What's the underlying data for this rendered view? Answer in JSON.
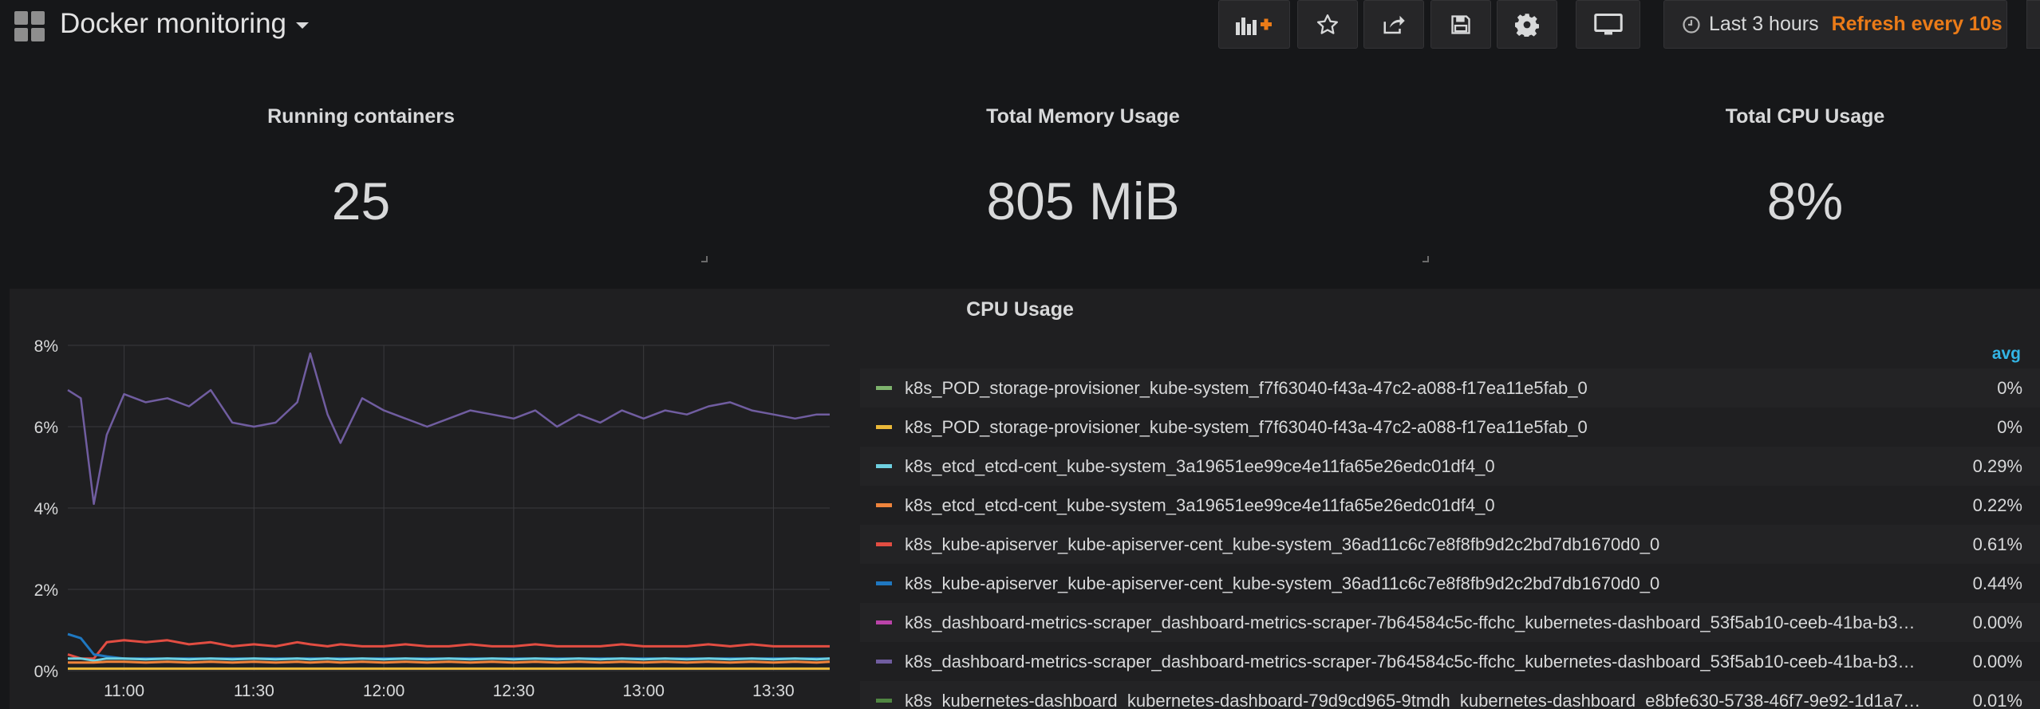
{
  "header": {
    "title": "Docker monitoring",
    "time_range": "Last 3 hours",
    "refresh": "Refresh every 10s",
    "buttons": [
      "add-panel-icon",
      "star-icon",
      "share-icon",
      "save-icon",
      "settings-icon",
      "tv-mode-icon"
    ]
  },
  "stats": [
    {
      "title": "Running containers",
      "value": "25"
    },
    {
      "title": "Total Memory Usage",
      "value": "805 MiB"
    },
    {
      "title": "Total CPU Usage",
      "value": "8%"
    }
  ],
  "graph": {
    "title": "CPU Usage",
    "legend_header": "avg",
    "legend": [
      {
        "name": "k8s_POD_storage-provisioner_kube-system_f7f63040-f43a-47c2-a088-f17ea11e5fab_0",
        "value": "0%",
        "color": "#7eb26d"
      },
      {
        "name": "k8s_POD_storage-provisioner_kube-system_f7f63040-f43a-47c2-a088-f17ea11e5fab_0",
        "value": "0%",
        "color": "#eab839"
      },
      {
        "name": "k8s_etcd_etcd-cent_kube-system_3a19651ee99ce4e11fa65e26edc01df4_0",
        "value": "0.29%",
        "color": "#6ed0e0"
      },
      {
        "name": "k8s_etcd_etcd-cent_kube-system_3a19651ee99ce4e11fa65e26edc01df4_0",
        "value": "0.22%",
        "color": "#ef843c"
      },
      {
        "name": "k8s_kube-apiserver_kube-apiserver-cent_kube-system_36ad11c6c7e8f8fb9d2c2bd7db1670d0_0",
        "value": "0.61%",
        "color": "#e24d42"
      },
      {
        "name": "k8s_kube-apiserver_kube-apiserver-cent_kube-system_36ad11c6c7e8f8fb9d2c2bd7db1670d0_0",
        "value": "0.44%",
        "color": "#1f78c1"
      },
      {
        "name": "k8s_dashboard-metrics-scraper_dashboard-metrics-scraper-7b64584c5c-ffchc_kubernetes-dashboard_53f5ab10-ceeb-41ba-b3…",
        "value": "0.00%",
        "color": "#ba43a9"
      },
      {
        "name": "k8s_dashboard-metrics-scraper_dashboard-metrics-scraper-7b64584c5c-ffchc_kubernetes-dashboard_53f5ab10-ceeb-41ba-b3…",
        "value": "0.00%",
        "color": "#705da0"
      },
      {
        "name": "k8s_kubernetes-dashboard_kubernetes-dashboard-79d9cd965-9tmdh_kubernetes-dashboard_e8bfe630-5738-46f7-9e92-1d1a7…",
        "value": "0.01%",
        "color": "#508642"
      }
    ]
  },
  "chart_data": {
    "type": "line",
    "title": "CPU Usage",
    "x_ticks": [
      "11:00",
      "11:30",
      "12:00",
      "12:30",
      "13:00",
      "13:30"
    ],
    "y_ticks": [
      "0%",
      "2%",
      "4%",
      "6%",
      "8%"
    ],
    "ylim": [
      0,
      8
    ],
    "x": [
      "10:47",
      "10:50",
      "10:53",
      "10:56",
      "11:00",
      "11:05",
      "11:10",
      "11:15",
      "11:20",
      "11:25",
      "11:30",
      "11:35",
      "11:40",
      "11:43",
      "11:47",
      "11:50",
      "11:55",
      "12:00",
      "12:05",
      "12:10",
      "12:15",
      "12:20",
      "12:25",
      "12:30",
      "12:35",
      "12:40",
      "12:45",
      "12:50",
      "12:55",
      "13:00",
      "13:05",
      "13:10",
      "13:15",
      "13:20",
      "13:25",
      "13:30",
      "13:35",
      "13:40",
      "13:43"
    ],
    "series": [
      {
        "color": "#705da0",
        "values": [
          6.9,
          6.7,
          4.1,
          5.8,
          6.8,
          6.6,
          6.7,
          6.5,
          6.9,
          6.1,
          6.0,
          6.1,
          6.6,
          7.8,
          6.3,
          5.6,
          6.7,
          6.4,
          6.2,
          6.0,
          6.2,
          6.4,
          6.3,
          6.2,
          6.4,
          6.0,
          6.3,
          6.1,
          6.4,
          6.2,
          6.4,
          6.3,
          6.5,
          6.6,
          6.4,
          6.3,
          6.2,
          6.3,
          6.3
        ]
      },
      {
        "color": "#e24d42",
        "values": [
          0.4,
          0.3,
          0.3,
          0.7,
          0.75,
          0.7,
          0.75,
          0.65,
          0.7,
          0.6,
          0.65,
          0.6,
          0.7,
          0.65,
          0.6,
          0.65,
          0.6,
          0.6,
          0.65,
          0.6,
          0.6,
          0.65,
          0.6,
          0.6,
          0.65,
          0.6,
          0.6,
          0.6,
          0.65,
          0.6,
          0.6,
          0.6,
          0.65,
          0.6,
          0.65,
          0.6,
          0.6,
          0.6,
          0.6
        ]
      },
      {
        "color": "#1f78c1",
        "values": [
          0.9,
          0.8,
          0.4,
          0.35,
          0.3,
          0.3,
          0.3,
          0.3,
          0.3,
          0.3,
          0.3,
          0.3,
          0.3,
          0.3,
          0.3,
          0.3,
          0.3,
          0.3,
          0.3,
          0.3,
          0.3,
          0.3,
          0.3,
          0.3,
          0.3,
          0.3,
          0.3,
          0.3,
          0.3,
          0.3,
          0.3,
          0.3,
          0.3,
          0.3,
          0.3,
          0.3,
          0.3,
          0.3,
          0.3
        ]
      },
      {
        "color": "#6ed0e0",
        "values": [
          0.3,
          0.3,
          0.25,
          0.3,
          0.3,
          0.28,
          0.3,
          0.28,
          0.3,
          0.28,
          0.3,
          0.28,
          0.3,
          0.28,
          0.3,
          0.28,
          0.3,
          0.28,
          0.3,
          0.28,
          0.3,
          0.28,
          0.3,
          0.28,
          0.3,
          0.28,
          0.3,
          0.28,
          0.3,
          0.28,
          0.3,
          0.28,
          0.3,
          0.28,
          0.3,
          0.28,
          0.3,
          0.28,
          0.3
        ]
      },
      {
        "color": "#ef843c",
        "values": [
          0.2,
          0.2,
          0.2,
          0.22,
          0.22,
          0.2,
          0.22,
          0.2,
          0.22,
          0.2,
          0.22,
          0.2,
          0.22,
          0.2,
          0.22,
          0.2,
          0.22,
          0.2,
          0.22,
          0.2,
          0.22,
          0.2,
          0.22,
          0.2,
          0.22,
          0.2,
          0.22,
          0.2,
          0.22,
          0.2,
          0.22,
          0.2,
          0.22,
          0.2,
          0.22,
          0.2,
          0.22,
          0.2,
          0.22
        ]
      },
      {
        "color": "#eab839",
        "values": [
          0.05,
          0.05,
          0.05,
          0.05,
          0.05,
          0.05,
          0.05,
          0.05,
          0.05,
          0.05,
          0.05,
          0.05,
          0.05,
          0.05,
          0.05,
          0.05,
          0.05,
          0.05,
          0.05,
          0.05,
          0.05,
          0.05,
          0.05,
          0.05,
          0.05,
          0.05,
          0.05,
          0.05,
          0.05,
          0.05,
          0.05,
          0.05,
          0.05,
          0.05,
          0.05,
          0.05,
          0.05,
          0.05,
          0.05
        ]
      }
    ]
  }
}
